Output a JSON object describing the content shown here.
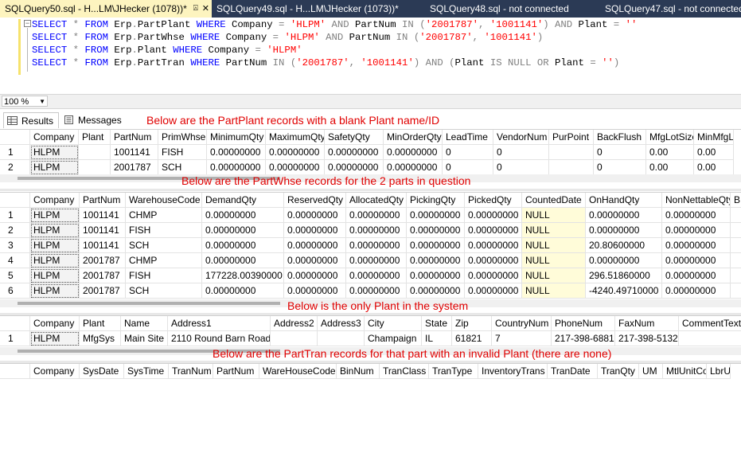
{
  "tabs": [
    {
      "label": "SQLQuery50.sql - H...LM\\JHecker (1078))*",
      "pin": "⍓",
      "close": "✕"
    },
    {
      "label": "SQLQuery49.sql - H...LM\\JHecker (1073))*"
    },
    {
      "label": "SQLQuery48.sql - not connected"
    },
    {
      "label": "SQLQuery47.sql - not connected"
    }
  ],
  "zoom": "100 %",
  "results_tabs": {
    "results": "Results",
    "messages": "Messages"
  },
  "notes": {
    "n1": "Below are the PartPlant records with a blank Plant name/ID",
    "n2": "Below are the PartWhse records for the 2 parts in question",
    "n3": "Below is the only Plant in the system",
    "n4": "Below are the PartTran records for that part with an invalid Plant (there are none)"
  },
  "grid1": {
    "headers": [
      "",
      "Company",
      "Plant",
      "PartNum",
      "PrimWhse",
      "MinimumQty",
      "MaximumQty",
      "SafetyQty",
      "MinOrderQty",
      "LeadTime",
      "VendorNum",
      "PurPoint",
      "BackFlush",
      "MfgLotSize",
      "MinMfgLo"
    ],
    "rows": [
      [
        "1",
        "HLPM",
        "",
        "1001141",
        "FISH",
        "0.00000000",
        "0.00000000",
        "0.00000000",
        "0.00000000",
        "0",
        "0",
        "",
        "0",
        "0.00",
        "0.00"
      ],
      [
        "2",
        "HLPM",
        "",
        "2001787",
        "SCH",
        "0.00000000",
        "0.00000000",
        "0.00000000",
        "0.00000000",
        "0",
        "0",
        "",
        "0",
        "0.00",
        "0.00"
      ]
    ]
  },
  "grid2": {
    "headers": [
      "",
      "Company",
      "PartNum",
      "WarehouseCode",
      "DemandQty",
      "ReservedQty",
      "AllocatedQty",
      "PickingQty",
      "PickedQty",
      "CountedDate",
      "OnHandQty",
      "NonNettableQty",
      "B"
    ],
    "rows": [
      [
        "1",
        "HLPM",
        "1001141",
        "CHMP",
        "0.00000000",
        "0.00000000",
        "0.00000000",
        "0.00000000",
        "0.00000000",
        "NULL",
        "0.00000000",
        "0.00000000",
        ""
      ],
      [
        "2",
        "HLPM",
        "1001141",
        "FISH",
        "0.00000000",
        "0.00000000",
        "0.00000000",
        "0.00000000",
        "0.00000000",
        "NULL",
        "0.00000000",
        "0.00000000",
        ""
      ],
      [
        "3",
        "HLPM",
        "1001141",
        "SCH",
        "0.00000000",
        "0.00000000",
        "0.00000000",
        "0.00000000",
        "0.00000000",
        "NULL",
        "20.80600000",
        "0.00000000",
        ""
      ],
      [
        "4",
        "HLPM",
        "2001787",
        "CHMP",
        "0.00000000",
        "0.00000000",
        "0.00000000",
        "0.00000000",
        "0.00000000",
        "NULL",
        "0.00000000",
        "0.00000000",
        ""
      ],
      [
        "5",
        "HLPM",
        "2001787",
        "FISH",
        "177228.00390000",
        "0.00000000",
        "0.00000000",
        "0.00000000",
        "0.00000000",
        "NULL",
        "296.51860000",
        "0.00000000",
        ""
      ],
      [
        "6",
        "HLPM",
        "2001787",
        "SCH",
        "0.00000000",
        "0.00000000",
        "0.00000000",
        "0.00000000",
        "0.00000000",
        "NULL",
        "-4240.49710000",
        "0.00000000",
        ""
      ]
    ]
  },
  "grid3": {
    "headers": [
      "",
      "Company",
      "Plant",
      "Name",
      "Address1",
      "Address2",
      "Address3",
      "City",
      "State",
      "Zip",
      "CountryNum",
      "PhoneNum",
      "FaxNum",
      "CommentText"
    ],
    "rows": [
      [
        "1",
        "HLPM",
        "MfgSys",
        "Main Site",
        "2110 Round Barn Road",
        "",
        "",
        "Champaign",
        "IL",
        "61821",
        "7",
        "217-398-6881",
        "217-398-5132",
        ""
      ]
    ]
  },
  "grid4": {
    "headers": [
      "",
      "Company",
      "SysDate",
      "SysTime",
      "TranNum",
      "PartNum",
      "WareHouseCode",
      "BinNum",
      "TranClass",
      "TranType",
      "InventoryTrans",
      "TranDate",
      "TranQty",
      "UM",
      "MtlUnitCost",
      "LbrU"
    ],
    "rows": []
  },
  "colors": {
    "tabbar": "#2b3a55",
    "active_tab": "#fdf4bf",
    "note": "#e00000",
    "keyword": "#0000ff",
    "string": "#ff0000"
  }
}
